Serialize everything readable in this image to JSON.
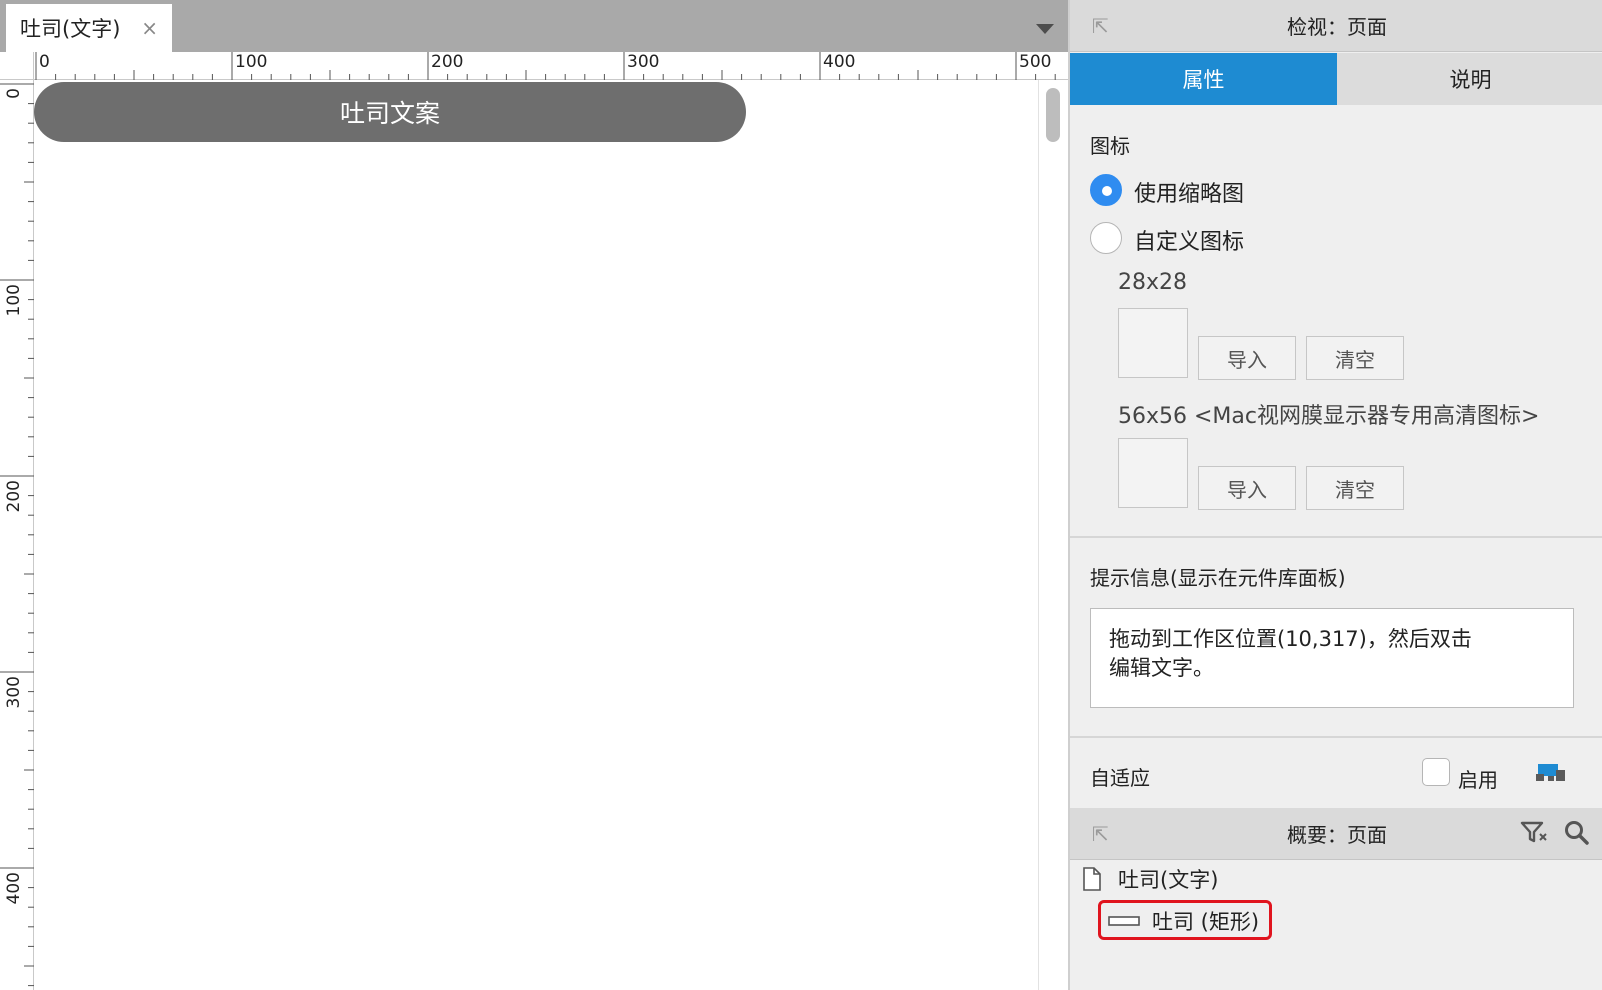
{
  "document_tab": {
    "title": "吐司(文字)",
    "close_icon": "×"
  },
  "rulers": {
    "horizontal_labels": [
      "0",
      "100",
      "200",
      "300",
      "400",
      "500"
    ],
    "vertical_labels": [
      "0",
      "100",
      "200",
      "300",
      "400"
    ]
  },
  "canvas": {
    "widget_text": "吐司文案",
    "widget_color": "#6e6e6e"
  },
  "inspector": {
    "header_title": "检视：页面",
    "tabs": [
      {
        "label": "属性",
        "active": true
      },
      {
        "label": "说明",
        "active": false
      }
    ],
    "icon_section": {
      "title": "图标",
      "options": [
        {
          "label": "使用缩略图",
          "selected": true
        },
        {
          "label": "自定义图标",
          "selected": false
        }
      ],
      "size_small": "28x28",
      "size_large": "56x56 <Mac视网膜显示器专用高清图标>",
      "import_label": "导入",
      "clear_label": "清空"
    },
    "tooltip_section": {
      "title": "提示信息(显示在元件库面板)",
      "text_line1": "拖动到工作区位置(10,317)，然后双击",
      "text_line2": "编辑文字。"
    },
    "adaptive_section": {
      "title": "自适应",
      "enable_label": "启用",
      "enabled": false
    }
  },
  "outline": {
    "header_title": "概要：页面",
    "page_item": "吐司(文字)",
    "child_item": "吐司 (矩形)"
  },
  "colors": {
    "accent": "#1e8bd2",
    "highlight": "#e0141e"
  }
}
